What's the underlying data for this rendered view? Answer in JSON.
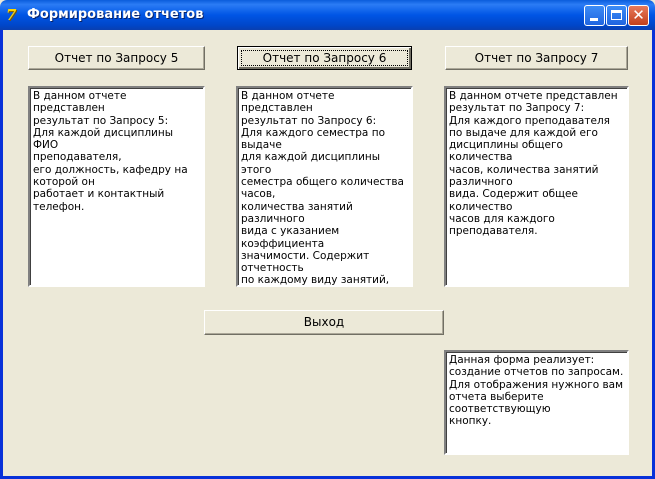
{
  "window": {
    "title": "Формирование отчетов",
    "controls": {
      "minimize": "minimize-icon",
      "maximize": "maximize-icon",
      "close": "close-icon"
    }
  },
  "buttons": {
    "report5": "Отчет по Запросу 5",
    "report6": "Отчет по Запросу 6",
    "report7": "Отчет по Запросу 7",
    "exit": "Выход"
  },
  "memos": {
    "report5": "В данном отчете представлен\nрезультат по Запросу 5:\nДля каждой дисциплины ФИО\nпреподавателя,\nего должность, кафедру на\nкоторой он\nработает и контактный телефон.",
    "report6": "В данном отчете представлен\nрезультат по Запросу 6:\nДля каждого семестра по\nвыдаче\nдля каждой дисциплины этого\nсеместра общего количества\nчасов,\nколичества занятий различного\nвида с указанием коэффициента\nзначимости. Содержит\nотчетность\nпо каждому виду занятий, ФИО\nпреподавателя.",
    "report7": "В данном отчете представлен\nрезультат по Запросу 7:\nДля каждого преподавателя\nпо выдаче для каждой его\nдисциплины общего количества\nчасов, количества занятий\nразличного\nвида. Содержит общее количество\nчасов для каждого преподавателя.",
    "info": "Данная форма реализует:\nсоздание отчетов по запросам.\nДля отображения нужного вам\nотчета выберите\nсоответствующую\nкнопку."
  },
  "colors": {
    "titlebar": "#0055e5",
    "window_bg": "#ece9d8",
    "close_button": "#c2401c"
  }
}
